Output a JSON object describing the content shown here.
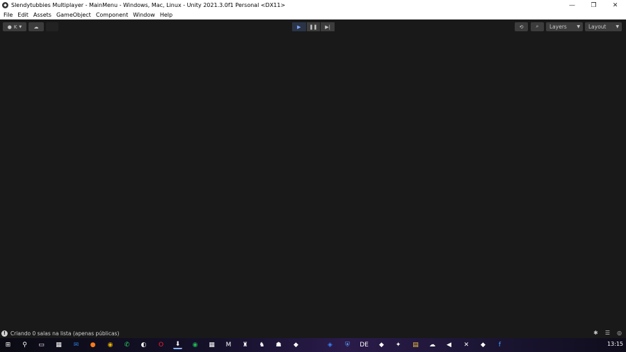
{
  "window": {
    "title": "Slendytubbies Multiplayer - MainMenu - Windows, Mac, Linux - Unity 2021.3.0f1 Personal <DX11>",
    "controls": {
      "minimize": "—",
      "restore": "❐",
      "close": "✕"
    }
  },
  "menu": [
    "File",
    "Edit",
    "Assets",
    "GameObject",
    "Component",
    "Window",
    "Help"
  ],
  "toolbar": {
    "account_label": "K",
    "cloud_icon": "cloud-icon",
    "layers_label": "Layers",
    "layout_label": "Layout",
    "play_state": "playing"
  },
  "status": {
    "message": "Criando 0 salas na lista (apenas públicas)"
  },
  "taskbar": {
    "clock": "13:15",
    "apps": [
      "start",
      "search",
      "task-view",
      "calculator",
      "outlook",
      "firefox",
      "chrome",
      "whatsapp",
      "steam",
      "opera",
      "installer",
      "spotify",
      "app-grid",
      "app-m",
      "app-game1",
      "app-game2",
      "app-game3",
      "app-dark",
      "app-blue",
      "app-shield",
      "app-de",
      "unity",
      "app-purple",
      "explorer",
      "app-cloud",
      "app-audio",
      "app-x",
      "unity-2",
      "app-f"
    ]
  },
  "colors": {
    "background": "#191919",
    "titlebar": "#ffffff",
    "accent_play": "#7aa6ff"
  }
}
